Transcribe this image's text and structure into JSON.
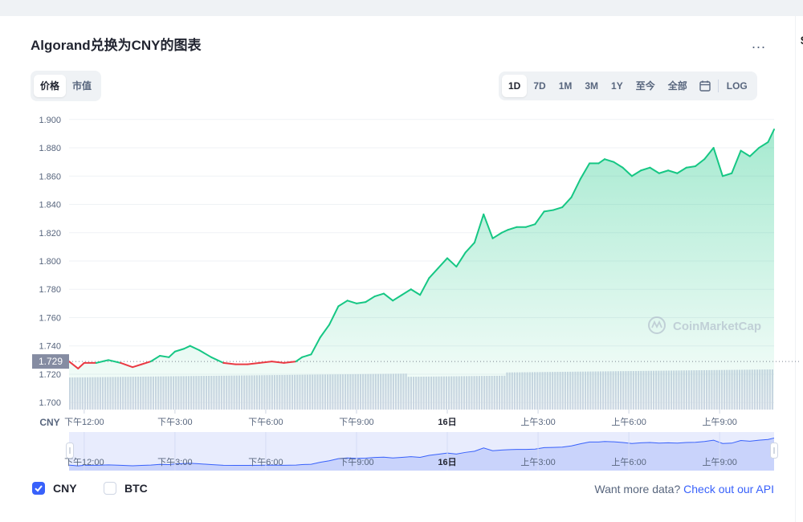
{
  "header": {
    "title": "Algorand兑换为CNY的图表",
    "more_label": "...",
    "edge_char": "$"
  },
  "view_toggle": [
    "价格",
    "市值"
  ],
  "ranges": [
    "1D",
    "7D",
    "1M",
    "3M",
    "1Y",
    "至今",
    "全部"
  ],
  "log_label": "LOG",
  "current_price_tag": "1.729",
  "currency_label": "CNY",
  "watermark": "CoinMarketCap",
  "legend": [
    {
      "label": "CNY",
      "checked": true
    },
    {
      "label": "BTC",
      "checked": false
    }
  ],
  "footer": {
    "prompt": "Want more data?",
    "link": "Check out our API"
  },
  "colors": {
    "up": "#16c784",
    "down": "#ea3943",
    "accent": "#3861fb",
    "volume": "#cfd6e4"
  },
  "icons": [
    "more-dots-icon",
    "calendar-icon",
    "coinmarketcap-logo-icon",
    "checkbox-checked-icon",
    "checkbox-unchecked-icon",
    "drag-handle-icon"
  ],
  "chart_data": {
    "type": "line",
    "title": "Algorand兑换为CNY的图表",
    "ylabel": "",
    "ylim": [
      1.695,
      1.905
    ],
    "yticks": [
      "1.900",
      "1.880",
      "1.860",
      "1.840",
      "1.820",
      "1.800",
      "1.780",
      "1.760",
      "1.740",
      "1.720",
      "1.700"
    ],
    "ytick_values": [
      1.9,
      1.88,
      1.86,
      1.84,
      1.82,
      1.8,
      1.78,
      1.76,
      1.74,
      1.72,
      1.7
    ],
    "reference_value": 1.729,
    "xlim": [
      11.5,
      34.8
    ],
    "xticks": [
      {
        "t": 12,
        "label": "下午12:00"
      },
      {
        "t": 15,
        "label": "下午3:00"
      },
      {
        "t": 18,
        "label": "下午6:00"
      },
      {
        "t": 21,
        "label": "下午9:00"
      },
      {
        "t": 24,
        "label": "16日"
      },
      {
        "t": 27,
        "label": "上午3:00"
      },
      {
        "t": 30,
        "label": "上午6:00"
      },
      {
        "t": 33,
        "label": "上午9:00"
      }
    ],
    "series": [
      {
        "x": [
          11.5,
          11.8,
          12.0,
          12.4,
          12.8,
          13.2,
          13.6,
          13.9,
          14.2,
          14.5,
          14.8,
          15.0,
          15.3,
          15.5,
          15.8,
          16.2,
          16.6,
          17.0,
          17.4,
          17.8,
          18.2,
          18.6,
          19.0,
          19.2,
          19.5,
          19.8,
          20.1,
          20.4,
          20.7,
          21.0,
          21.3,
          21.6,
          21.9,
          22.2,
          22.5,
          22.8,
          23.1,
          23.4,
          23.7,
          24.0,
          24.3,
          24.6,
          24.9,
          25.2,
          25.5,
          25.8,
          26.0,
          26.3,
          26.6,
          26.9,
          27.2,
          27.5,
          27.8,
          28.1,
          28.4,
          28.7,
          29.0,
          29.2,
          29.5,
          29.8,
          30.1,
          30.4,
          30.7,
          31.0,
          31.3,
          31.6,
          31.9,
          32.2,
          32.5,
          32.8,
          33.1,
          33.4,
          33.7,
          34.0,
          34.3,
          34.6,
          34.8
        ],
        "y": [
          1.729,
          1.724,
          1.728,
          1.728,
          1.73,
          1.728,
          1.725,
          1.727,
          1.729,
          1.733,
          1.732,
          1.736,
          1.738,
          1.74,
          1.737,
          1.732,
          1.728,
          1.727,
          1.727,
          1.728,
          1.729,
          1.728,
          1.729,
          1.732,
          1.734,
          1.746,
          1.755,
          1.768,
          1.772,
          1.77,
          1.771,
          1.775,
          1.777,
          1.772,
          1.776,
          1.78,
          1.776,
          1.788,
          1.795,
          1.802,
          1.796,
          1.806,
          1.813,
          1.833,
          1.816,
          1.82,
          1.822,
          1.824,
          1.824,
          1.826,
          1.835,
          1.836,
          1.838,
          1.845,
          1.858,
          1.869,
          1.869,
          1.872,
          1.87,
          1.866,
          1.86,
          1.864,
          1.866,
          1.862,
          1.864,
          1.862,
          1.866,
          1.867,
          1.872,
          1.88,
          1.86,
          1.862,
          1.878,
          1.874,
          1.88,
          1.884,
          1.893
        ]
      }
    ],
    "volume": [
      3,
      3,
      3,
      3,
      3,
      3,
      3,
      3,
      3,
      3,
      3,
      3,
      3,
      3,
      3,
      3,
      3,
      3,
      3,
      3,
      3,
      3,
      3,
      3,
      3,
      3,
      3,
      3,
      3,
      3,
      3,
      3,
      3,
      3,
      3,
      3,
      3,
      3,
      3,
      3,
      3,
      3,
      3,
      3,
      3,
      3,
      3,
      3,
      3,
      3,
      3,
      3,
      3,
      3,
      3,
      3,
      3,
      3,
      3,
      3,
      3,
      3,
      3,
      3,
      3,
      3,
      3,
      3,
      3,
      3,
      3,
      3,
      3,
      3,
      3,
      3,
      3,
      3,
      3,
      3,
      3,
      3,
      3,
      3,
      3,
      3,
      3,
      3,
      3,
      3,
      3,
      3,
      3,
      3,
      3,
      3,
      3,
      3,
      3,
      3,
      3,
      3,
      3,
      3,
      3,
      3,
      3,
      3,
      3,
      3,
      3,
      3,
      3,
      3,
      3,
      3,
      3,
      3,
      3,
      3,
      3,
      3,
      3,
      3,
      3,
      3,
      3,
      3,
      3,
      3,
      3,
      3,
      3,
      3,
      3,
      3,
      3,
      3,
      3,
      3,
      3,
      3,
      3,
      3,
      3,
      3,
      3,
      3,
      3,
      3,
      3,
      3,
      3,
      3,
      3,
      3,
      3,
      3,
      3,
      3,
      3,
      3,
      3,
      3,
      3,
      3,
      3,
      3,
      3,
      3,
      3,
      3,
      3,
      3,
      3,
      3,
      3,
      3,
      3,
      3,
      3,
      3,
      3,
      3,
      3,
      3,
      3,
      3,
      3,
      3,
      3,
      3,
      3,
      3,
      3,
      3,
      3,
      3,
      3,
      3,
      3,
      3,
      3,
      3,
      3,
      3,
      3,
      3,
      3,
      3,
      3,
      3,
      3,
      3,
      3,
      3,
      3,
      3,
      3,
      3,
      3,
      3,
      3,
      3,
      3,
      3,
      3,
      3,
      3,
      3,
      3,
      3,
      3,
      3,
      3,
      3,
      3,
      3,
      3,
      3,
      3,
      3,
      3,
      3,
      3,
      3,
      3,
      3,
      3,
      3,
      3,
      3,
      3,
      3,
      3,
      3,
      3,
      3,
      3,
      3,
      3,
      3,
      3,
      3,
      3,
      3,
      3,
      3,
      3,
      3,
      3,
      3,
      3,
      3,
      3,
      3,
      3,
      3,
      3
    ]
  }
}
